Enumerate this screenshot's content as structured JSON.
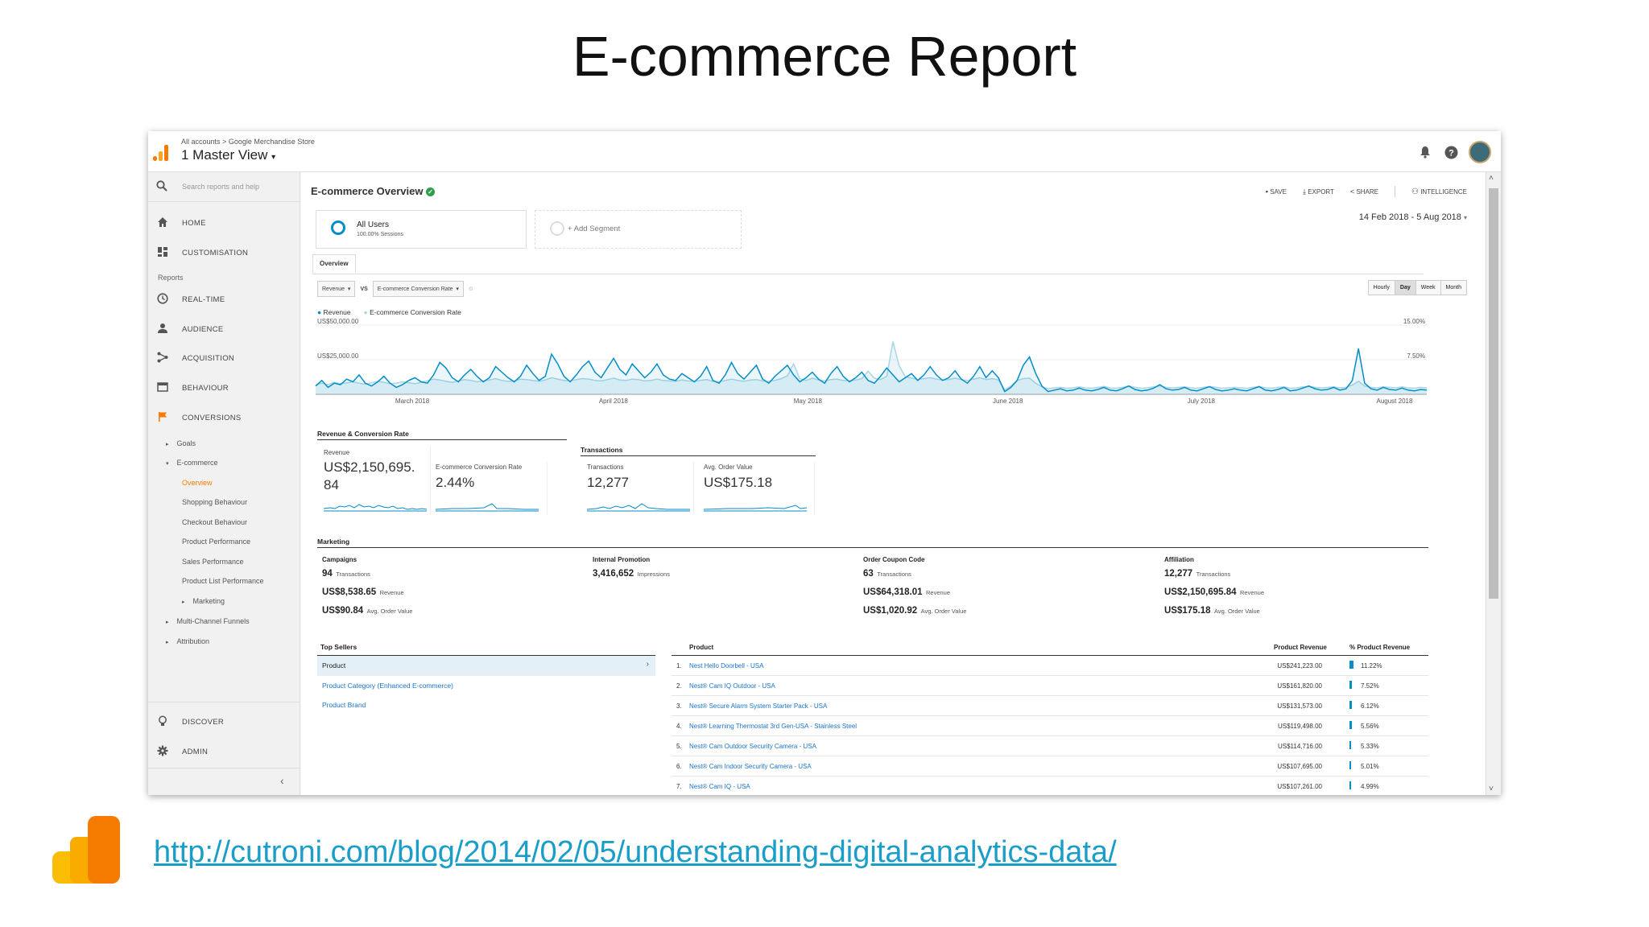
{
  "slide": {
    "title": "E-commerce Report",
    "url": "http://cutroni.com/blog/2014/02/05/understanding-digital-analytics-data/"
  },
  "colors": {
    "accent": "#1a73c8",
    "ga_orange": "#f57c00",
    "ga_yellow": "#fbbc04",
    "revenue_line": "#058dc7",
    "conv_line": "#a9d6e5"
  },
  "topbar": {
    "breadcrumb_1": "All accounts",
    "breadcrumb_sep": ">",
    "breadcrumb_2": "Google Merchandise Store",
    "view_name": "1 Master View"
  },
  "sidebar": {
    "search_placeholder": "Search reports and help",
    "items": [
      {
        "label": "HOME",
        "icon": "home-icon"
      },
      {
        "label": "CUSTOMISATION",
        "icon": "dashboard-icon"
      },
      {
        "label": "REAL-TIME",
        "icon": "clock-icon"
      },
      {
        "label": "AUDIENCE",
        "icon": "person-icon"
      },
      {
        "label": "ACQUISITION",
        "icon": "acquisition-icon"
      },
      {
        "label": "BEHAVIOUR",
        "icon": "behaviour-icon"
      },
      {
        "label": "CONVERSIONS",
        "icon": "flag-icon"
      },
      {
        "label": "DISCOVER",
        "icon": "bulb-icon"
      },
      {
        "label": "ADMIN",
        "icon": "gear-icon"
      }
    ],
    "reports_heading": "Reports",
    "sub": {
      "goals": "Goals",
      "ecommerce": "E-commerce",
      "overview": "Overview",
      "shopping": "Shopping Behaviour",
      "checkout": "Checkout Behaviour",
      "product_perf": "Product Performance",
      "sales_perf": "Sales Performance",
      "product_list": "Product List Performance",
      "marketing": "Marketing",
      "mcf": "Multi-Channel Funnels",
      "attribution": "Attribution"
    }
  },
  "report": {
    "title": "E-commerce Overview",
    "actions": {
      "save": "SAVE",
      "export": "EXPORT",
      "share": "SHARE",
      "intelligence": "INTELLIGENCE"
    },
    "segment": {
      "name": "All Users",
      "sub": "100.00% Sessions",
      "add": "+ Add Segment"
    },
    "date_range": "14 Feb 2018 - 5 Aug 2018",
    "tab": "Overview",
    "metric1": "Revenue",
    "vs": "VS",
    "metric2": "E-commerce Conversion Rate",
    "granularity": [
      "Hourly",
      "Day",
      "Week",
      "Month"
    ],
    "legend": [
      "Revenue",
      "E-commerce Conversion Rate"
    ]
  },
  "chart_data": {
    "type": "line",
    "x_labels": [
      "March 2018",
      "April 2018",
      "May 2018",
      "June 2018",
      "July 2018",
      "August 2018"
    ],
    "y_left_ticks": [
      "US$50,000.00",
      "US$25,000.00"
    ],
    "y_right_ticks": [
      "15.00%",
      "7.50%"
    ],
    "ylim_left": [
      0,
      50000
    ],
    "ylim_right": [
      0,
      15
    ],
    "series": [
      {
        "name": "Revenue",
        "values": [
          6000,
          10000,
          5000,
          8000,
          7000,
          11000,
          9000,
          14000,
          8000,
          6000,
          9000,
          13000,
          8000,
          5000,
          7000,
          10000,
          12000,
          9000,
          8000,
          14000,
          23000,
          19000,
          12000,
          9000,
          14000,
          18000,
          13000,
          9000,
          12000,
          20000,
          16000,
          12000,
          9000,
          13000,
          21000,
          15000,
          10000,
          13000,
          29000,
          22000,
          13000,
          9000,
          14000,
          20000,
          24000,
          16000,
          12000,
          19000,
          26000,
          18000,
          14000,
          22000,
          17000,
          12000,
          16000,
          22000,
          14000,
          11000,
          10000,
          15000,
          12000,
          9000,
          13000,
          20000,
          10000,
          8000,
          14000,
          23000,
          15000,
          11000,
          16000,
          21000,
          11000,
          8000,
          13000,
          17000,
          21000,
          14000,
          9000,
          12000,
          16000,
          11000,
          8000,
          15000,
          20000,
          13000,
          9000,
          12000,
          16000,
          10000,
          8000,
          13000,
          19000,
          14000,
          9000,
          12000,
          15000,
          10000,
          14000,
          20000,
          14000,
          10000,
          12000,
          17000,
          11000,
          8000,
          13000,
          20000,
          12000,
          17000,
          12000,
          2000,
          5000,
          10000,
          21000,
          27000,
          15000,
          6000,
          2000,
          3000,
          4000,
          2500,
          3000,
          4500,
          3000,
          2500,
          3500,
          5000,
          3000,
          2500,
          4000,
          6000,
          3500,
          2500,
          3000,
          4500,
          7000,
          4000,
          3000,
          3500,
          5000,
          3000,
          2500,
          4000,
          5500,
          3500,
          2500,
          3000,
          4000,
          3000,
          2500,
          4000,
          5500,
          3000,
          2500,
          3500,
          5000,
          2500,
          3000,
          4500,
          6000,
          4000,
          3000,
          3500,
          5000,
          3000,
          4000,
          10000,
          33000,
          8000,
          4000,
          3000,
          5000,
          3500,
          3000,
          4500,
          3000,
          2500,
          3500,
          3000
        ]
      },
      {
        "name": "E-commerce Conversion Rate",
        "values": [
          2.0,
          2.4,
          2.1,
          2.6,
          2.3,
          2.5,
          2.7,
          2.4,
          2.2,
          2.5,
          2.8,
          2.6,
          2.3,
          2.4,
          2.7,
          2.5,
          2.3,
          2.6,
          2.9,
          3.3,
          3.1,
          2.8,
          2.6,
          2.9,
          3.2,
          3.0,
          2.7,
          2.9,
          3.1,
          3.4,
          3.0,
          2.8,
          2.9,
          3.3,
          3.2,
          3.0,
          2.8,
          3.1,
          3.6,
          3.3,
          3.0,
          2.9,
          3.2,
          3.4,
          3.3,
          3.0,
          2.9,
          3.2,
          3.5,
          3.1,
          3.0,
          3.3,
          3.2,
          2.9,
          3.0,
          3.3,
          3.0,
          2.9,
          2.8,
          3.1,
          2.9,
          2.8,
          3.0,
          3.2,
          2.8,
          2.7,
          3.0,
          3.3,
          3.0,
          2.8,
          3.1,
          3.2,
          2.9,
          2.8,
          3.0,
          3.4,
          4.0,
          6.6,
          3.4,
          3.0,
          3.5,
          3.1,
          2.9,
          3.2,
          3.3,
          3.0,
          2.9,
          3.1,
          3.4,
          5.0,
          3.5,
          3.2,
          3.9,
          11.4,
          6.2,
          3.8,
          3.5,
          3.2,
          3.4,
          3.6,
          3.3,
          3.1,
          3.2,
          3.5,
          3.2,
          3.0,
          3.3,
          3.6,
          3.2,
          3.4,
          3.1,
          1.0,
          1.8,
          3.0,
          3.4,
          3.5,
          2.4,
          1.6,
          1.2,
          1.4,
          1.5,
          1.3,
          1.4,
          1.6,
          1.4,
          1.3,
          1.5,
          1.7,
          1.4,
          1.3,
          1.5,
          1.8,
          1.5,
          1.3,
          1.4,
          1.6,
          1.8,
          1.5,
          1.4,
          1.5,
          1.6,
          1.4,
          1.3,
          1.5,
          1.7,
          1.5,
          1.3,
          1.4,
          1.5,
          1.4,
          1.3,
          1.5,
          1.7,
          1.4,
          1.3,
          1.5,
          1.6,
          1.3,
          1.4,
          1.6,
          1.7,
          1.5,
          1.4,
          1.5,
          1.6,
          1.4,
          1.5,
          2.0,
          2.8,
          1.8,
          1.5,
          1.4,
          1.6,
          1.5,
          1.4,
          1.6,
          1.4,
          1.3,
          1.5,
          1.4
        ]
      }
    ]
  },
  "summary": {
    "rev_conv_heading": "Revenue & Conversion Rate",
    "transactions_heading": "Transactions",
    "revenue_label": "Revenue",
    "revenue_value_1": "US$2,150,695.",
    "revenue_value_2": "84",
    "conv_label": "E-commerce Conversion Rate",
    "conv_value": "2.44%",
    "trans_label": "Transactions",
    "trans_value": "12,277",
    "aov_label": "Avg. Order Value",
    "aov_value": "US$175.18"
  },
  "marketing": {
    "heading": "Marketing",
    "campaigns": {
      "title": "Campaigns",
      "v1": "94",
      "l1": "Transactions",
      "v2": "US$8,538.65",
      "l2": "Revenue",
      "v3": "US$90.84",
      "l3": "Avg. Order Value"
    },
    "internal": {
      "title": "Internal Promotion",
      "v1": "3,416,652",
      "l1": "Impressions"
    },
    "coupon": {
      "title": "Order Coupon Code",
      "v1": "63",
      "l1": "Transactions",
      "v2": "US$64,318.01",
      "l2": "Revenue",
      "v3": "US$1,020.92",
      "l3": "Avg. Order Value"
    },
    "affiliation": {
      "title": "Affiliation",
      "v1": "12,277",
      "l1": "Transactions",
      "v2": "US$2,150,695.84",
      "l2": "Revenue",
      "v3": "US$175.18",
      "l3": "Avg. Order Value"
    }
  },
  "top_sellers": {
    "heading": "Top Sellers",
    "options": [
      "Product",
      "Product Category (Enhanced E-commerce)",
      "Product Brand"
    ],
    "columns": {
      "product": "Product",
      "revenue": "Product Revenue",
      "pct": "% Product Revenue"
    },
    "rows": [
      {
        "rank": "1.",
        "name": "Nest Hello Doorbell - USA",
        "revenue": "US$241,223.00",
        "pct": "11.22%",
        "pct_value": 11.22
      },
      {
        "rank": "2.",
        "name": "Nest® Cam IQ Outdoor - USA",
        "revenue": "US$161,820.00",
        "pct": "7.52%",
        "pct_value": 7.52
      },
      {
        "rank": "3.",
        "name": "Nest® Secure Alarm System Starter Pack - USA",
        "revenue": "US$131,573.00",
        "pct": "6.12%",
        "pct_value": 6.12
      },
      {
        "rank": "4.",
        "name": "Nest® Learning Thermostat 3rd Gen-USA - Stainless Steel",
        "revenue": "US$119,498.00",
        "pct": "5.56%",
        "pct_value": 5.56
      },
      {
        "rank": "5.",
        "name": "Nest® Cam Outdoor Security Camera - USA",
        "revenue": "US$114,716.00",
        "pct": "5.33%",
        "pct_value": 5.33
      },
      {
        "rank": "6.",
        "name": "Nest® Cam Indoor Security Camera - USA",
        "revenue": "US$107,695.00",
        "pct": "5.01%",
        "pct_value": 5.01
      },
      {
        "rank": "7.",
        "name": "Nest® Cam IQ - USA",
        "revenue": "US$107,261.00",
        "pct": "4.99%",
        "pct_value": 4.99
      }
    ]
  }
}
